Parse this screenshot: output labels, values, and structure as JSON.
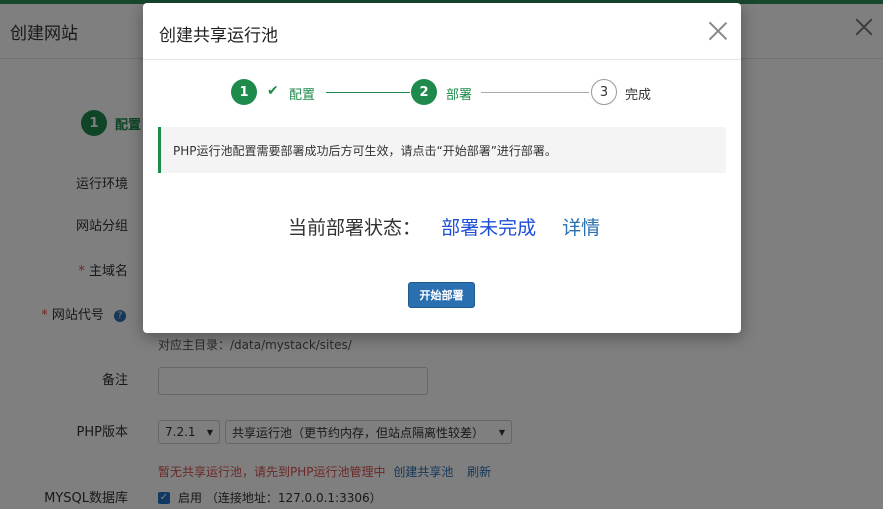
{
  "background_dialog": {
    "title": "创建网站",
    "step": {
      "number": "1",
      "label": "配置"
    },
    "labels": {
      "runtime_env": "运行环境",
      "site_group": "网站分组",
      "primary_domain": "主域名",
      "site_code": "网站代号",
      "remark": "备注",
      "php_version": "PHP版本",
      "mysql_db": "MYSQL数据库"
    },
    "required_marker": "*",
    "help_icon": "?",
    "root_dir_hint": "对应主目录：/data/mystack/sites/",
    "php_version_value": "7.2.1",
    "pool_select_value": "共享运行池（更节约内存，但站点隔离性较差）",
    "warning_text": "暂无共享运行池，请先到PHP运行池管理中",
    "create_pool_link": "创建共享池",
    "refresh_link": "刷新",
    "mysql_checkbox_label": "启用 （连接地址：127.0.0.1:3306）"
  },
  "modal": {
    "title": "创建共享运行池",
    "steps": [
      {
        "number": "1",
        "label": "配置",
        "state": "done"
      },
      {
        "number": "2",
        "label": "部署",
        "state": "active"
      },
      {
        "number": "3",
        "label": "完成",
        "state": "pending"
      }
    ],
    "notice": "PHP运行池配置需要部署成功后方可生效，请点击“开始部署”进行部署。",
    "status_label": "当前部署状态：",
    "status_value": "部署未完成",
    "details_link": "详情",
    "start_button": "开始部署"
  },
  "colors": {
    "accent_green": "#1e8a4c",
    "link_blue": "#2a6fb0",
    "status_blue": "#1c4ed8",
    "warning_red": "#d9534f"
  }
}
